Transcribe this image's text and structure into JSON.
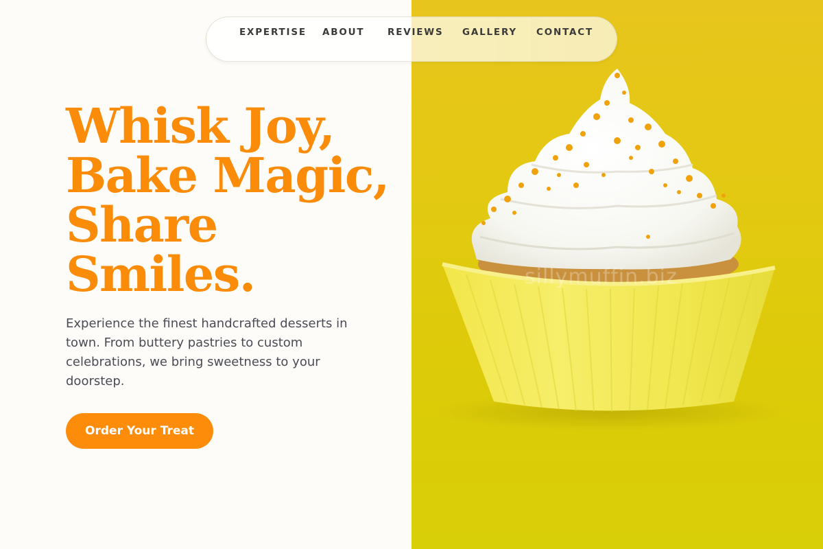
{
  "nav": {
    "items": [
      {
        "label": "EXPERTISE"
      },
      {
        "label": "ABOUT"
      },
      {
        "label": "REVIEWS"
      },
      {
        "label": "GALLERY"
      },
      {
        "label": "CONTACT"
      }
    ]
  },
  "hero": {
    "title_lines": [
      "Whisk Joy,",
      "Bake Magic,",
      "Share",
      "Smiles."
    ],
    "description": "Experience the finest handcrafted desserts in town. From buttery pastries to custom celebrations, we bring sweetness to your doorstep.",
    "cta_label": "Order Your Treat"
  },
  "image": {
    "subject": "cupcake-with-whipped-cream-and-orange-sprinkles",
    "watermark": "sillymuffin.biz"
  },
  "colors": {
    "accent": "#fc8c0a",
    "title": "#fb8c0a",
    "background": "#fefcf9",
    "photo_background": "#e3c912",
    "body_text": "#4a4b55"
  }
}
